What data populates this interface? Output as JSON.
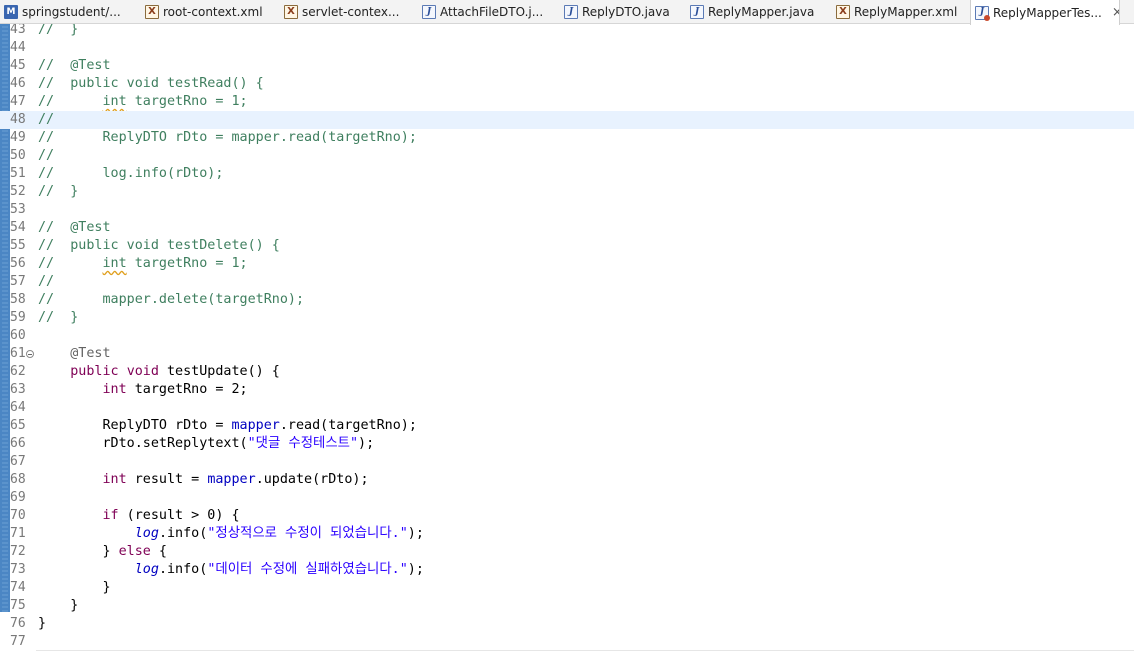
{
  "tabs": [
    {
      "label": "springstudent/...",
      "icon": "maven-pom-icon",
      "active": false
    },
    {
      "label": "root-context.xml",
      "icon": "xml-file-icon",
      "active": false
    },
    {
      "label": "servlet-contex...",
      "icon": "xml-file-icon",
      "active": false
    },
    {
      "label": "AttachFileDTO.j...",
      "icon": "java-file-icon",
      "active": false
    },
    {
      "label": "ReplyDTO.java",
      "icon": "java-file-icon",
      "active": false
    },
    {
      "label": "ReplyMapper.java",
      "icon": "java-file-icon",
      "active": false
    },
    {
      "label": "ReplyMapper.xml",
      "icon": "xml-file-icon",
      "active": false
    },
    {
      "label": "ReplyMapperTes...",
      "icon": "java-test-file-icon",
      "active": true,
      "close": "×"
    }
  ],
  "editor": {
    "current_line": 48,
    "lines": [
      {
        "n": "43",
        "t": [
          [
            "c",
            "//  }"
          ]
        ]
      },
      {
        "n": "44",
        "t": []
      },
      {
        "n": "45",
        "t": [
          [
            "c",
            "//  @Test"
          ]
        ]
      },
      {
        "n": "46",
        "t": [
          [
            "c",
            "//  public void testRead() {"
          ]
        ]
      },
      {
        "n": "47",
        "t": [
          [
            "c",
            "//      "
          ],
          [
            "cw",
            "int"
          ],
          [
            "c",
            " targetRno = 1;"
          ]
        ]
      },
      {
        "n": "48",
        "t": [
          [
            "c",
            "//"
          ]
        ]
      },
      {
        "n": "49",
        "t": [
          [
            "c",
            "//      ReplyDTO rDto = mapper.read(targetRno);"
          ]
        ]
      },
      {
        "n": "50",
        "t": [
          [
            "c",
            "//"
          ]
        ]
      },
      {
        "n": "51",
        "t": [
          [
            "c",
            "//      log.info(rDto);"
          ]
        ]
      },
      {
        "n": "52",
        "t": [
          [
            "c",
            "//  }"
          ]
        ]
      },
      {
        "n": "53",
        "t": []
      },
      {
        "n": "54",
        "t": [
          [
            "c",
            "//  @Test"
          ]
        ]
      },
      {
        "n": "55",
        "t": [
          [
            "c",
            "//  public void testDelete() {"
          ]
        ]
      },
      {
        "n": "56",
        "t": [
          [
            "c",
            "//      "
          ],
          [
            "cw",
            "int"
          ],
          [
            "c",
            " targetRno = 1;"
          ]
        ]
      },
      {
        "n": "57",
        "t": [
          [
            "c",
            "//"
          ]
        ]
      },
      {
        "n": "58",
        "t": [
          [
            "c",
            "//      mapper.delete(targetRno);"
          ]
        ]
      },
      {
        "n": "59",
        "t": [
          [
            "c",
            "//  }"
          ]
        ]
      },
      {
        "n": "60",
        "t": []
      },
      {
        "n": "61",
        "fold": true,
        "t": [
          [
            "tx",
            "    "
          ],
          [
            "ann",
            "@Test"
          ]
        ]
      },
      {
        "n": "62",
        "t": [
          [
            "tx",
            "    "
          ],
          [
            "kw",
            "public"
          ],
          [
            "tx",
            " "
          ],
          [
            "kw",
            "void"
          ],
          [
            "tx",
            " testUpdate() {"
          ]
        ]
      },
      {
        "n": "63",
        "t": [
          [
            "tx",
            "        "
          ],
          [
            "kw",
            "int"
          ],
          [
            "tx",
            " targetRno = 2;"
          ]
        ]
      },
      {
        "n": "64",
        "t": []
      },
      {
        "n": "65",
        "t": [
          [
            "tx",
            "        ReplyDTO rDto = "
          ],
          [
            "fld",
            "mapper"
          ],
          [
            "tx",
            ".read(targetRno);"
          ]
        ]
      },
      {
        "n": "66",
        "t": [
          [
            "tx",
            "        rDto.setReplytext("
          ],
          [
            "str",
            "\"댓글 수정테스트\""
          ],
          [
            "tx",
            ");"
          ]
        ]
      },
      {
        "n": "67",
        "t": []
      },
      {
        "n": "68",
        "t": [
          [
            "tx",
            "        "
          ],
          [
            "kw",
            "int"
          ],
          [
            "tx",
            " result = "
          ],
          [
            "fld",
            "mapper"
          ],
          [
            "tx",
            ".update(rDto);"
          ]
        ]
      },
      {
        "n": "69",
        "t": []
      },
      {
        "n": "70",
        "t": [
          [
            "tx",
            "        "
          ],
          [
            "kw",
            "if"
          ],
          [
            "tx",
            " (result > 0) {"
          ]
        ]
      },
      {
        "n": "71",
        "t": [
          [
            "tx",
            "            "
          ],
          [
            "sfld",
            "log"
          ],
          [
            "tx",
            ".info("
          ],
          [
            "str",
            "\"정상적으로 수정이 되었습니다.\""
          ],
          [
            "tx",
            ");"
          ]
        ]
      },
      {
        "n": "72",
        "t": [
          [
            "tx",
            "        } "
          ],
          [
            "kw",
            "else"
          ],
          [
            "tx",
            " {"
          ]
        ]
      },
      {
        "n": "73",
        "t": [
          [
            "tx",
            "            "
          ],
          [
            "sfld",
            "log"
          ],
          [
            "tx",
            ".info("
          ],
          [
            "str",
            "\"데이터 수정에 실패하였습니다.\""
          ],
          [
            "tx",
            ");"
          ]
        ]
      },
      {
        "n": "74",
        "t": [
          [
            "tx",
            "        }"
          ]
        ]
      },
      {
        "n": "75",
        "t": [
          [
            "tx",
            "    }"
          ]
        ]
      },
      {
        "n": "76",
        "t": [
          [
            "tx",
            "}"
          ]
        ]
      },
      {
        "n": "77",
        "t": []
      }
    ]
  },
  "colors": {
    "comment": "#3f7f5f",
    "keyword": "#7f0055",
    "annotation": "#646464",
    "string": "#2a00ff",
    "field": "#0000c0",
    "current_line_highlight": "#e8f2fe",
    "overview_ruler": "#4b86c4"
  }
}
